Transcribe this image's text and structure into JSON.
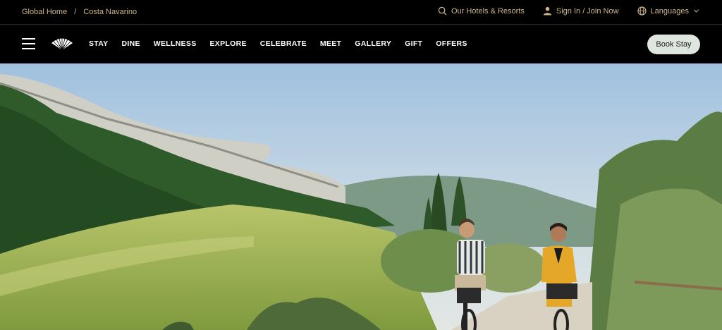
{
  "breadcrumb": {
    "home": "Global Home",
    "separator": "/",
    "current": "Costa Navarino"
  },
  "utility_links": {
    "hotels": "Our Hotels & Resorts",
    "signin": "Sign In / Join Now",
    "languages": "Languages"
  },
  "nav": {
    "items": [
      "STAY",
      "DINE",
      "WELLNESS",
      "EXPLORE",
      "CELEBRATE",
      "MEET",
      "GALLERY",
      "GIFT",
      "OFFERS"
    ],
    "book_label": "Book Stay"
  },
  "colors": {
    "accent_gold": "#cdb78a",
    "book_button_bg": "#dfe6df",
    "bar_bg": "#000000"
  },
  "icons": [
    "menu-icon",
    "fan-logo-icon",
    "search-icon",
    "user-icon",
    "globe-icon",
    "chevron-down-icon"
  ]
}
